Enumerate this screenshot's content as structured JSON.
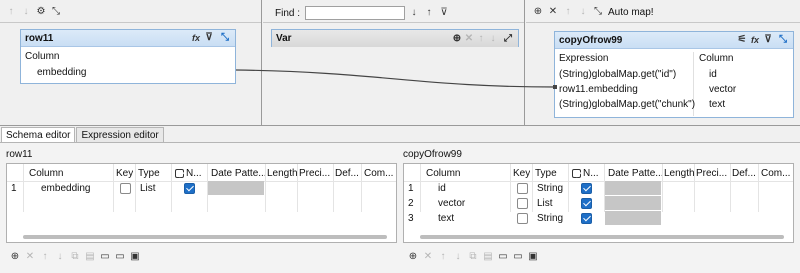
{
  "find": {
    "label": "Find :",
    "value": ""
  },
  "auto_map": "Auto map!",
  "input_table": {
    "title": "row11",
    "rows": [
      "Column",
      "embedding"
    ]
  },
  "var_table": {
    "title": "Var"
  },
  "output_table": {
    "title": "copyOfrow99",
    "headers": {
      "expression": "Expression",
      "column": "Column"
    },
    "rows": [
      {
        "expression": "(String)globalMap.get(\"id\")",
        "column": "id"
      },
      {
        "expression": "row11.embedding",
        "column": "vector"
      },
      {
        "expression": "(String)globalMap.get(\"chunk\")",
        "column": "text"
      }
    ]
  },
  "tabs": [
    "Schema editor",
    "Expression editor"
  ],
  "schema_left": {
    "title": "row11",
    "headers": [
      "Column",
      "Key",
      "Type",
      "N...",
      "Date Patte...",
      "Length",
      "Preci...",
      "Def...",
      "Com..."
    ],
    "rows": [
      {
        "num": "1",
        "column": "embedding",
        "key": false,
        "type": "List",
        "nullable": true
      }
    ]
  },
  "schema_right": {
    "title": "copyOfrow99",
    "headers": [
      "Column",
      "Key",
      "Type",
      "N...",
      "Date Patte...",
      "Length",
      "Preci...",
      "Def...",
      "Com..."
    ],
    "rows": [
      {
        "num": "1",
        "column": "id",
        "key": false,
        "type": "String",
        "nullable": true
      },
      {
        "num": "2",
        "column": "vector",
        "key": false,
        "type": "List",
        "nullable": true
      },
      {
        "num": "3",
        "column": "text",
        "key": false,
        "type": "String",
        "nullable": true
      }
    ]
  },
  "colors": {
    "accent": "#1e6fc7",
    "header": "#c9def4",
    "link_line": "#444444"
  }
}
